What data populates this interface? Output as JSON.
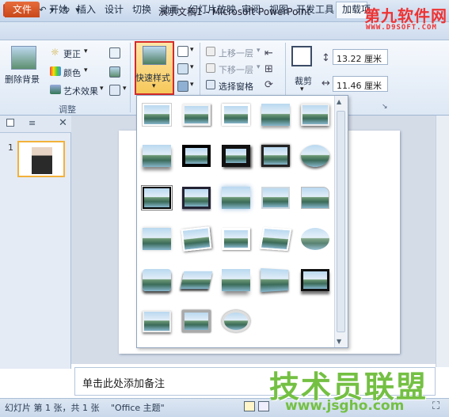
{
  "window": {
    "title": "演示文稿1 - Microsoft PowerPoint",
    "app_icon": "P"
  },
  "watermark_top": {
    "line1": "第九软件网",
    "line2": "WWW.D9SOFT.COM"
  },
  "tabs": {
    "file": "文件",
    "items": [
      "开始",
      "插入",
      "设计",
      "切换",
      "动画",
      "幻灯片放映",
      "审阅",
      "视图",
      "开发工具",
      "加载项"
    ]
  },
  "ribbon": {
    "remove_bg": "删除背景",
    "corrections": "更正",
    "color": "颜色",
    "artistic": "艺术效果",
    "adjust_group": "调整",
    "quick_styles": "快速样式",
    "bring_forward": "上移一层",
    "send_backward": "下移一层",
    "selection_pane": "选择窗格",
    "crop": "裁剪",
    "height": "13.22 厘米",
    "width": "11.46 厘米"
  },
  "slides": {
    "thumb_number": "1"
  },
  "gallery": {
    "rows": 6,
    "items_per_row": 5,
    "last_row_items": 3
  },
  "notes": {
    "placeholder": "单击此处添加备注"
  },
  "status": {
    "slide_info": "幻灯片 第 1 张，共 1 张",
    "theme": "\"Office 主题\""
  },
  "watermark_bottom": {
    "text": "技术员联盟",
    "url": "www.jsgho.com"
  }
}
